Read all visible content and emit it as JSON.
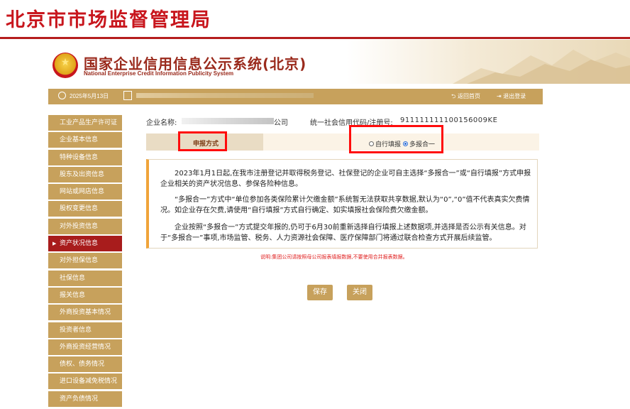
{
  "header": {
    "bureau_title": "北京市市场监督管理局",
    "system_title_cn": "国家企业信用信息公示系统(北京)",
    "system_title_en": "National Enterprise Credit Information Publicity System"
  },
  "topbar": {
    "date": "2025年5月13日",
    "back_home": "返回首页",
    "logout": "退出登录"
  },
  "sidebar": {
    "items": [
      {
        "label": "工业产品生产许可证",
        "active": false
      },
      {
        "label": "企业基本信息",
        "active": false
      },
      {
        "label": "特种设备信息",
        "active": false
      },
      {
        "label": "股东及出资信息",
        "active": false
      },
      {
        "label": "网站或网店信息",
        "active": false
      },
      {
        "label": "股权变更信息",
        "active": false
      },
      {
        "label": "对外投资信息",
        "active": false
      },
      {
        "label": "资产状况信息",
        "active": true
      },
      {
        "label": "对外担保信息",
        "active": false
      },
      {
        "label": "社保信息",
        "active": false
      },
      {
        "label": "报关信息",
        "active": false
      },
      {
        "label": "外商投资基本情况",
        "active": false
      },
      {
        "label": "投资者信息",
        "active": false
      },
      {
        "label": "外商投资经营情况",
        "active": false
      },
      {
        "label": "债权、债务情况",
        "active": false
      },
      {
        "label": "进口设备减免税情况",
        "active": false
      },
      {
        "label": "资产负债情况",
        "active": false
      }
    ]
  },
  "company": {
    "name_label": "企业名称:",
    "name_tail": "公司",
    "credit_label": "统一社会信用代码/注册号:",
    "credit_value": "911111111100156009KE"
  },
  "report_mode": {
    "label": "申报方式",
    "options": [
      {
        "label": "自行填报",
        "checked": false
      },
      {
        "label": "多报合一",
        "checked": true
      }
    ]
  },
  "notice": {
    "p1": "2023年1月1日起,在我市注册登记并取得税务登记、社保登记的企业可自主选择“多报合一”或“自行填报”方式申报企业相关的资产状况信息、参保各险种信息。",
    "p2": "“多报合一”方式中“单位参加各类保险累计欠缴金额”系统暂无法获取共享数据,默认为“0”,“0”值不代表真实欠费情况。如企业存在欠费,请使用“自行填报”方式自行确定、如实填报社会保险费欠缴金额。",
    "p3": "企业按照“多报合一”方式提交年报的,仍可于6月30前重新选择自行填报上述数据项,并选择是否公示有关信息。对于“多报合一”事项,市场监管、税务、人力资源社会保障、医疗保障部门将通过联合检查方式开展后续监管。"
  },
  "note_red": "说明:集团公司请按照母公司报表填报数据,不要使用合并报表数据。",
  "buttons": {
    "save": "保存",
    "close": "关闭"
  },
  "colors": {
    "brand_red": "#c8161d",
    "gold": "#c7a15c",
    "active_red": "#a81c1c",
    "highlight": "#ff0c0c"
  }
}
